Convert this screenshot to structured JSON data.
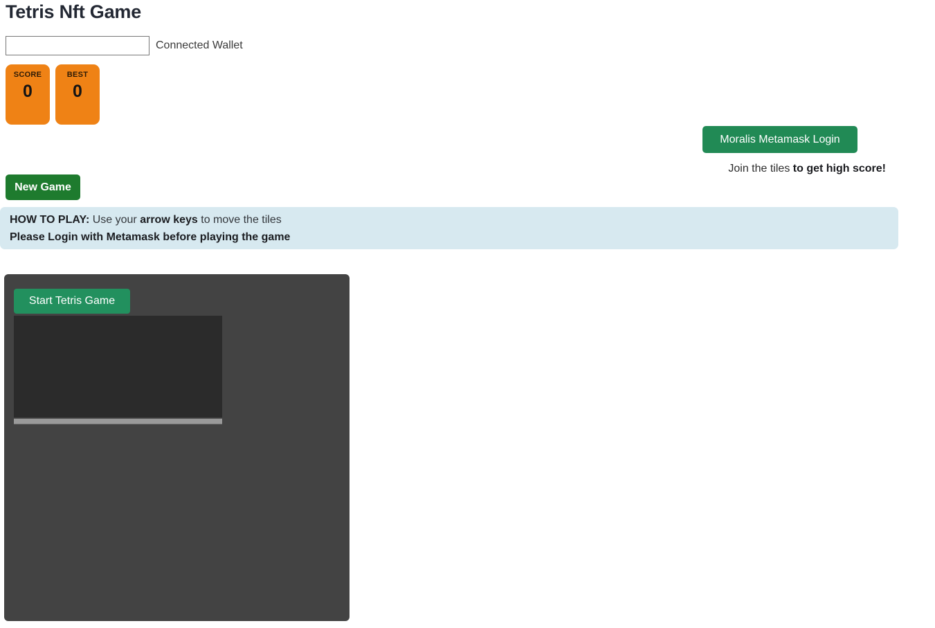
{
  "page": {
    "title": "Tetris Nft Game"
  },
  "wallet": {
    "value": "",
    "placeholder": "",
    "label": "Connected Wallet"
  },
  "scores": [
    {
      "label": "SCORE",
      "value": "0"
    },
    {
      "label": "BEST",
      "value": "0"
    }
  ],
  "auth": {
    "login_label": "Moralis Metamask Login",
    "tagline_normal": "Join the tiles ",
    "tagline_bold": "to get high score!"
  },
  "controls": {
    "new_game_label": "New Game"
  },
  "instructions": {
    "line1_bold_prefix": "HOW TO PLAY:",
    "line1_normal_a": " Use your ",
    "line1_bold_mid": "arrow keys",
    "line1_normal_b": " to move the tiles",
    "line2": "Please Login with Metamask before playing the game"
  },
  "game": {
    "start_label": "Start Tetris Game"
  },
  "colors": {
    "score_box": "#ef8215",
    "login_green": "#218a55",
    "new_game_green": "#1e7b2e",
    "start_green": "#22905e",
    "panel_blue": "#d7e9f0",
    "game_bg": "#434343",
    "canvas_bg": "#2b2b2b",
    "title": "#232833"
  }
}
